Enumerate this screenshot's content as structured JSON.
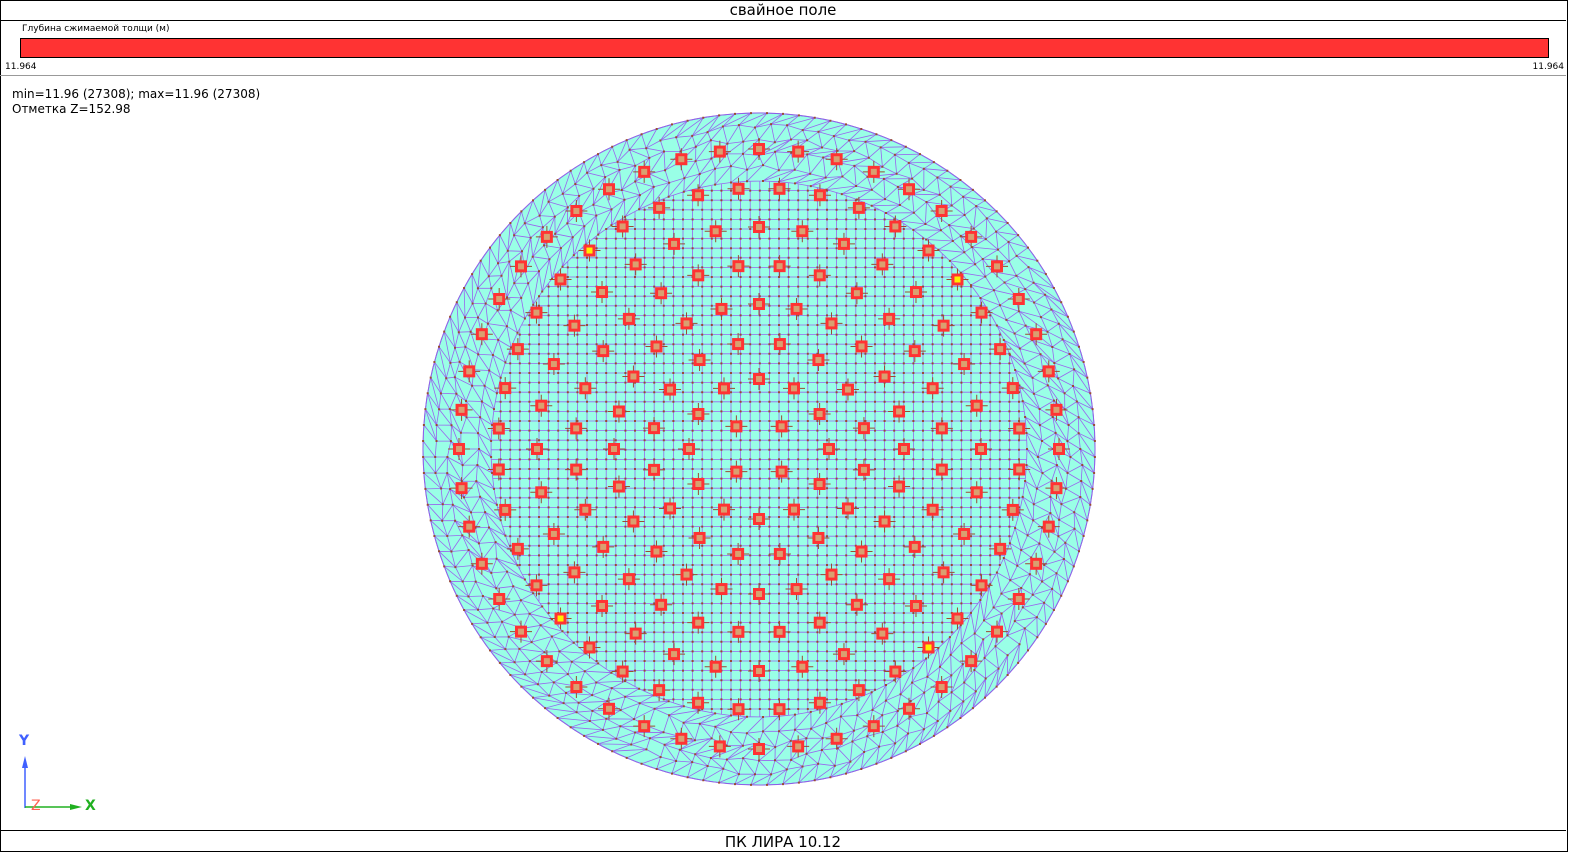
{
  "title": "свайное поле",
  "legend": {
    "label": "Глубина сжимаемой толщи (м)",
    "min_value": "11.964",
    "max_value": "11.964",
    "bar_color": "#ff3333"
  },
  "info": {
    "minmax": "min=11.96 (27308); max=11.96 (27308)",
    "elevation": "Отметка Z=152.98"
  },
  "axes": {
    "y": "Y",
    "z": "Z",
    "x": "X"
  },
  "colors": {
    "mesh_fill": "#99ffe6",
    "mesh_line": "#9966ee",
    "node": "#994d33",
    "pile": "#ff3333",
    "pile_special": "#ffee00"
  },
  "footer": "ПК ЛИРА 10.12"
}
